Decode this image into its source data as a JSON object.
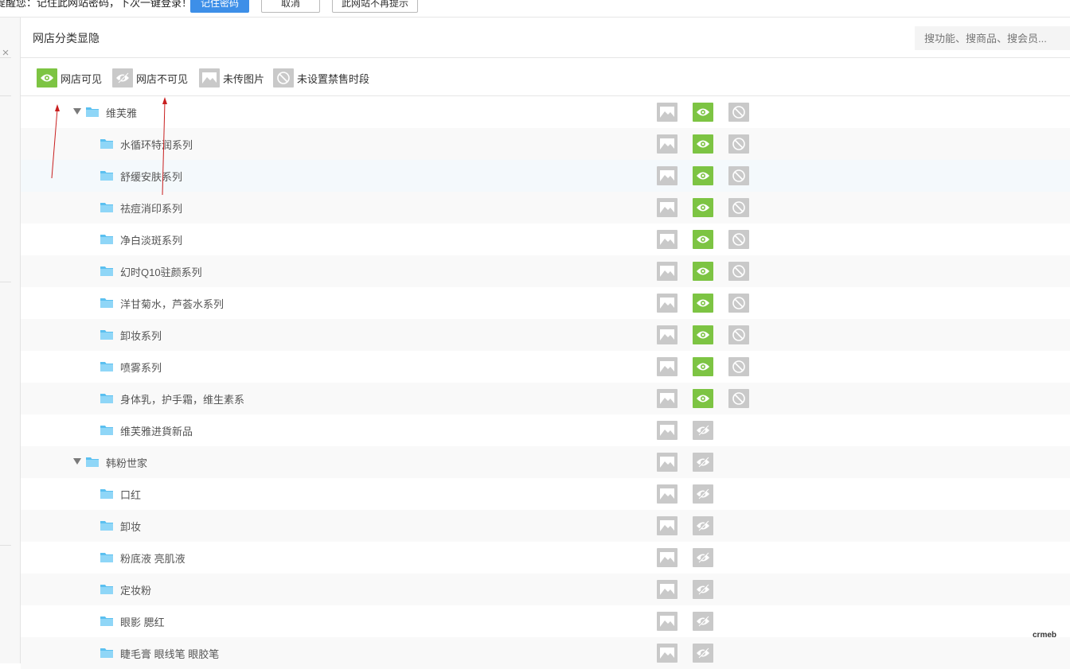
{
  "password_bar": {
    "message": "提醒您：记住此网站密码，下次一键登录！",
    "remember_label": "记住密码",
    "cancel_label": "取消",
    "never_label": "此网站不再提示"
  },
  "left_strip": {
    "close_glyph": "×"
  },
  "panel": {
    "title": "网店分类显隐",
    "search_placeholder": "搜功能、搜商品、搜会员..."
  },
  "legend": {
    "visible_label": "网店可见",
    "invisible_label": "网店不可见",
    "no_image_label": "未传图片",
    "no_ban_label": "未设置禁售时段"
  },
  "colors": {
    "visible_green": "#7dc443",
    "icon_gray": "#c9c9c9",
    "folder_blue": "#5bc0f0",
    "annotation_red": "#c81e1e",
    "primary_blue": "#3d8fe8"
  },
  "tree": {
    "rows": [
      {
        "name": "维芙雅",
        "level": 0,
        "expanded": true,
        "visible": true,
        "ban_icon": true
      },
      {
        "name": "水循环特润系列",
        "level": 1,
        "visible": true,
        "ban_icon": true
      },
      {
        "name": "舒缓安肤系列",
        "level": 1,
        "visible": true,
        "ban_icon": true
      },
      {
        "name": "祛痘消印系列",
        "level": 1,
        "visible": true,
        "ban_icon": true
      },
      {
        "name": "净白淡斑系列",
        "level": 1,
        "visible": true,
        "ban_icon": true
      },
      {
        "name": "幻时Q10驻颜系列",
        "level": 1,
        "visible": true,
        "ban_icon": true
      },
      {
        "name": "洋甘菊水，芦荟水系列",
        "level": 1,
        "visible": true,
        "ban_icon": true
      },
      {
        "name": "卸妆系列",
        "level": 1,
        "visible": true,
        "ban_icon": true
      },
      {
        "name": "喷雾系列",
        "level": 1,
        "visible": true,
        "ban_icon": true
      },
      {
        "name": "身体乳，护手霜，维生素系",
        "level": 1,
        "visible": true,
        "ban_icon": true
      },
      {
        "name": "维芙雅进貨新品",
        "level": 1,
        "visible": false,
        "ban_icon": false
      },
      {
        "name": "韩粉世家",
        "level": 0,
        "expanded": true,
        "visible": false,
        "ban_icon": false
      },
      {
        "name": "口红",
        "level": 1,
        "visible": false,
        "ban_icon": false
      },
      {
        "name": "卸妆",
        "level": 1,
        "visible": false,
        "ban_icon": false
      },
      {
        "name": "粉底液 亮肌液",
        "level": 1,
        "visible": false,
        "ban_icon": false
      },
      {
        "name": "定妆粉",
        "level": 1,
        "visible": false,
        "ban_icon": false
      },
      {
        "name": "眼影 腮红",
        "level": 1,
        "visible": false,
        "ban_icon": false
      },
      {
        "name": "睫毛膏 眼线笔 眼胶笔",
        "level": 1,
        "visible": false,
        "ban_icon": false
      }
    ]
  },
  "watermark": "crmeb"
}
